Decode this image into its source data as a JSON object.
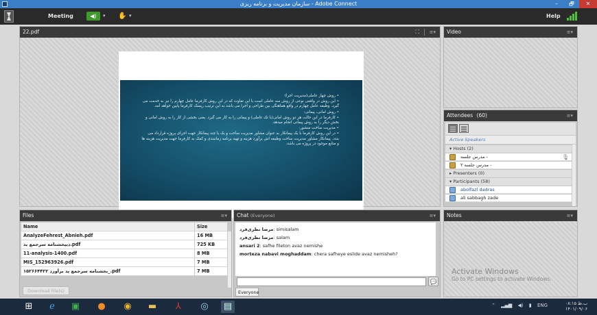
{
  "window": {
    "title": "سازمان مدیریت و برنامه ریزی - Adobe Connect",
    "min": "–",
    "max": "🗗",
    "close": "✕"
  },
  "menubar": {
    "meeting_label": "Meeting",
    "help_label": "Help",
    "speaker_icon": "◀)",
    "dropdown_arrow": "▾",
    "hand_icon": "✋"
  },
  "share_pod": {
    "title": "22.pdf",
    "fit_icon": "⛶",
    "menu_icon": "≡▾"
  },
  "slide": {
    "bullets": [
      "• روش چهار عاملی(مدیریت اجرا)",
      "• این روش در واقعی نوعی از روش سه عاملی است با این تفاوت که در این روش کارفرما عامل چهارم را نیز به خدمت می گیرد. وظیفه عامل چهارم در واقع هماهنگی بین طراحی و اجرا می باشد به این ترتیب ریسک کارفرما پایین خواهد آمد.",
      "• روش امانی، پیمانی:",
      "• کارفرما در این حالت هر دو روش امانی(با تک عاملی) و پیمانی را به کار می گیرد. یعنی بخشی از کار را به روش امانی و بخش دیگر را به روش پیمانی انجام میدهد.",
      "• مدیریت ساخت منشور:",
      "• در این روش کارفرما با یک پیمانکار به عنوان مشاور مدیریت ساخت و یک یا چند پیمانکار جهت اجرای پروژه قرارداد می بندد. پیمانکار مشاور مدیریت ساخت وظیفه اش برآورد هزینه و تهیه برنامه زمانبندی و کمک به کارفرما جهت مدیریت هزینه ها و منابع موجود در پروژه می باشد."
    ]
  },
  "video_pod": {
    "title": "Video",
    "menu_icon": "≡▾"
  },
  "attendees_pod": {
    "title": "Attendees",
    "count": "(60)",
    "menu_icon": "≡▾",
    "active_speakers_label": "Active Speakers",
    "sections": {
      "hosts": "▾ Hosts (2)",
      "presenters": "▸ Presenters (0)",
      "participants": "▾ Participants (58)"
    },
    "hosts": [
      "مدرس جلسه -",
      "مدرس جلسه ۲ -"
    ],
    "participants": [
      "abolfazl dadras",
      "ali sabbagh zade"
    ]
  },
  "files_pod": {
    "title": "Files",
    "menu_icon": "≡▾",
    "columns": {
      "name": "Name",
      "size": "Size"
    },
    "rows": [
      {
        "name": "AnalyzeFehrest_Abnieh.pdf",
        "size": "16 MB"
      },
      {
        "name": "دیپخشنامه سرجمع ید.pdf",
        "size": "725 KB"
      },
      {
        "name": "11-analysis-1400.pdf",
        "size": "8 MB"
      },
      {
        "name": "MIS_152963926.pdf",
        "size": "7 MB"
      },
      {
        "name": "بخشنامه سرجمع پد برآورد ۱۵۲۶۶۴۴۲۲_.pdf",
        "size": "7 MB"
      }
    ],
    "download_label": "Download File(s)"
  },
  "chat_pod": {
    "title": "Chat",
    "audience": "(Everyone)",
    "menu_icon": "≡▾",
    "messages": [
      {
        "sender": "مرضا نظری‌فرد",
        "text": ": simisalam"
      },
      {
        "sender": "مرضا نظری‌فرد",
        "text": ": salam"
      },
      {
        "sender": "ansari 2",
        "text": ": safhe fileton avaz nemishe"
      },
      {
        "sender": "morteza nabavi moghaddam",
        "text": ": chera safheye eslide avaz nemisheh?"
      }
    ],
    "send_icon": "💬",
    "tab_label": "Everyone"
  },
  "notes_pod": {
    "title": "Notes",
    "menu_icon": "≡▾"
  },
  "watermark": {
    "line1": "Activate Windows",
    "line2": "Go to PC settings to activate Windows."
  },
  "taskbar": {
    "icons": [
      "windows-start",
      "internet-explorer",
      "store",
      "firefox",
      "chrome",
      "file-explorer",
      "acrobat",
      "nox",
      "adobe-connect"
    ],
    "lang": "ENG",
    "time": "۰۸:۱۵ ب.ظ",
    "date": "۱۴۰۱/۰۹/۰۶"
  }
}
